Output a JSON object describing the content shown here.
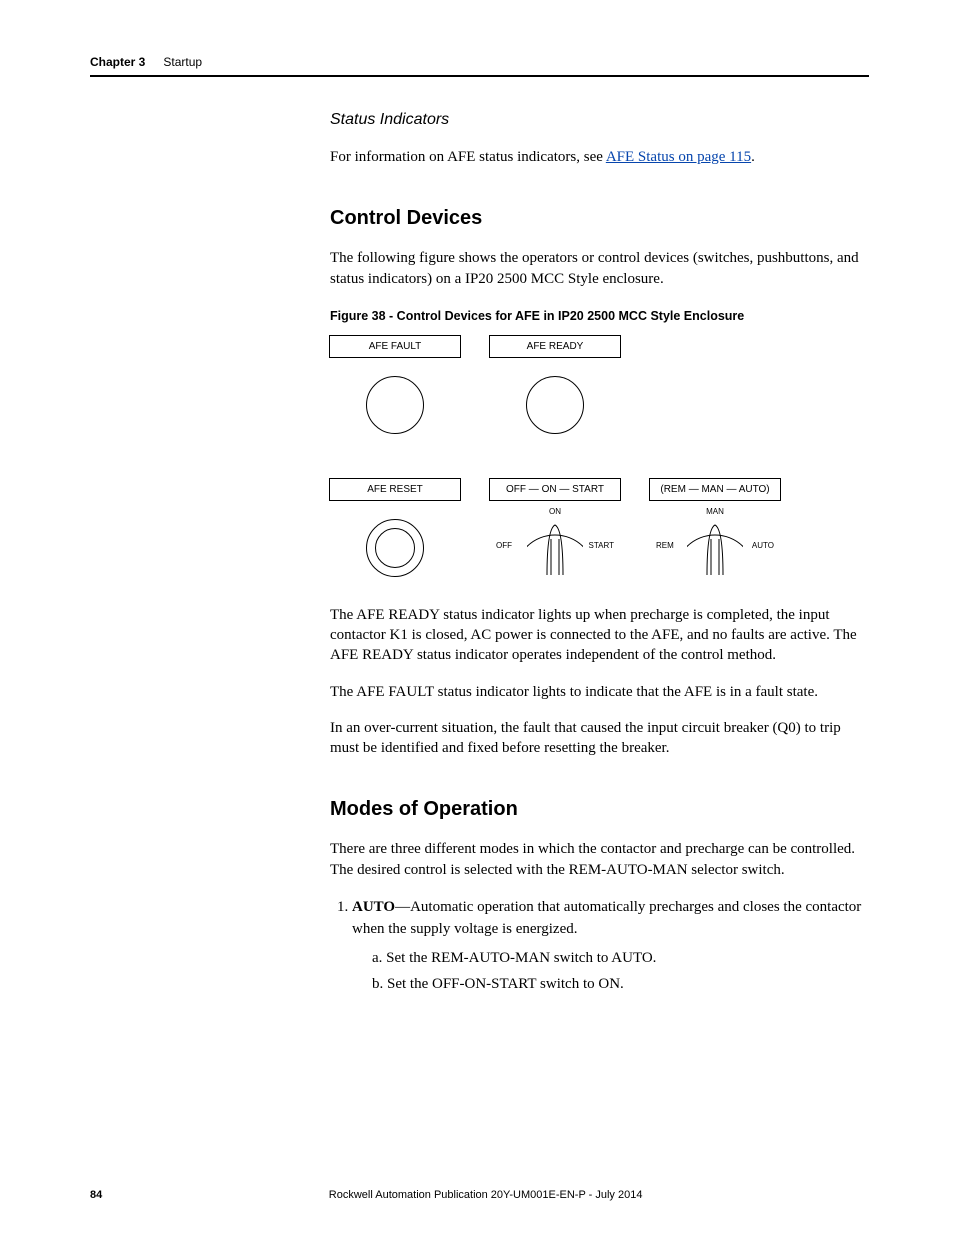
{
  "header": {
    "chapter": "Chapter 3",
    "title": "Startup"
  },
  "sections": {
    "status": {
      "heading": "Status Indicators",
      "text_before": "For information on AFE status indicators, see ",
      "link_text": "AFE Status on page 115",
      "text_after": "."
    },
    "control": {
      "heading": "Control Devices",
      "intro": "The following figure shows the operators or control devices (switches, pushbuttons, and status indicators) on a IP20 2500 MCC Style enclosure.",
      "figure_caption": "Figure 38 - Control Devices for AFE in IP20 2500 MCC Style Enclosure",
      "p_ready": "The AFE READY status indicator lights up when precharge is completed, the input contactor K1 is closed, AC power is connected to the AFE, and no faults are active. The AFE READY status indicator operates independent of the control method.",
      "p_fault": "The AFE FAULT status indicator lights to indicate that the AFE is in a fault state.",
      "p_overcurrent": "In an over-current situation, the fault that caused the input circuit breaker (Q0) to trip must be identified and fixed before resetting the breaker."
    },
    "modes": {
      "heading": "Modes of Operation",
      "intro": "There are three different modes in which the contactor and precharge can be controlled. The desired control is selected with the REM-AUTO-MAN selector switch.",
      "item1": {
        "label": "AUTO",
        "text": "—Automatic operation that automatically precharges and closes the contactor when the supply voltage is energized.",
        "sub": [
          "a.  Set the REM-AUTO-MAN switch to AUTO.",
          "b.  Set the OFF-ON-START switch to ON."
        ]
      }
    }
  },
  "figure": {
    "labels": [
      "AFE FAULT",
      "AFE READY",
      "AFE RESET",
      "OFF  —  ON  —  START",
      "(REM  —  MAN  —  AUTO)"
    ],
    "sw1": {
      "top": "ON",
      "left": "OFF",
      "right": "START"
    },
    "sw2": {
      "top": "MAN",
      "left": "REM",
      "right": "AUTO"
    }
  },
  "footer": {
    "page": "84",
    "publication": "Rockwell Automation Publication 20Y-UM001E-EN-P - July 2014"
  }
}
